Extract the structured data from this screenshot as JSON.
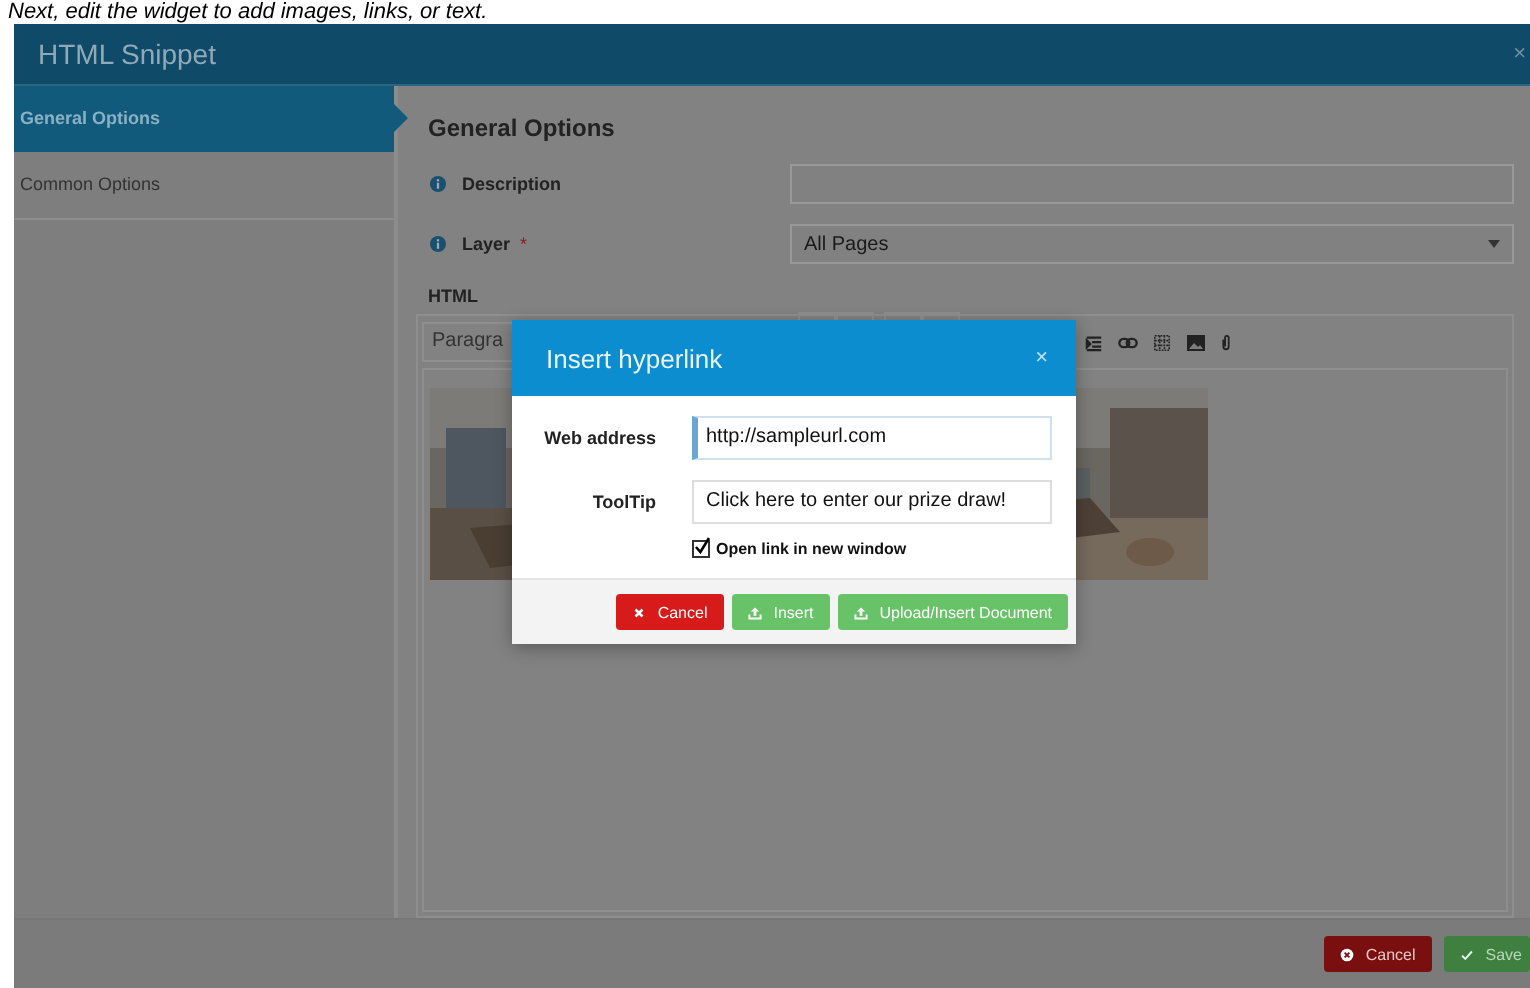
{
  "caption": "Next, edit the widget to add images, links, or text.",
  "window": {
    "title": "HTML Snippet",
    "close": "×"
  },
  "sidebar": {
    "items": [
      {
        "label": "General Options",
        "selected": true
      },
      {
        "label": "Common Options",
        "selected": false
      }
    ]
  },
  "section_title": "General Options",
  "fields": [
    {
      "kind": "text",
      "label": "Description",
      "required": false
    },
    {
      "kind": "select",
      "label": "Layer",
      "required": true,
      "value": "All Pages"
    }
  ],
  "required_mark": "*",
  "editor": {
    "label": "HTML",
    "format": "Paragra"
  },
  "dialog": {
    "title": "Insert hyperlink",
    "close": "×",
    "fields": [
      {
        "label": "Web address",
        "value": "http://sampleurl.com",
        "focused": true
      },
      {
        "label": "ToolTip",
        "value": "Click here to enter our prize draw!",
        "focused": false
      }
    ],
    "checkbox": {
      "label": "Open link in new window",
      "checked": true
    },
    "buttons": [
      {
        "kind": "danger",
        "label": "Cancel"
      },
      {
        "kind": "success",
        "label": "Insert"
      },
      {
        "kind": "success",
        "label": "Upload/Insert Document"
      }
    ]
  },
  "footer_buttons": [
    {
      "kind": "danger",
      "label": "Cancel"
    },
    {
      "kind": "success",
      "label": "Save"
    }
  ]
}
